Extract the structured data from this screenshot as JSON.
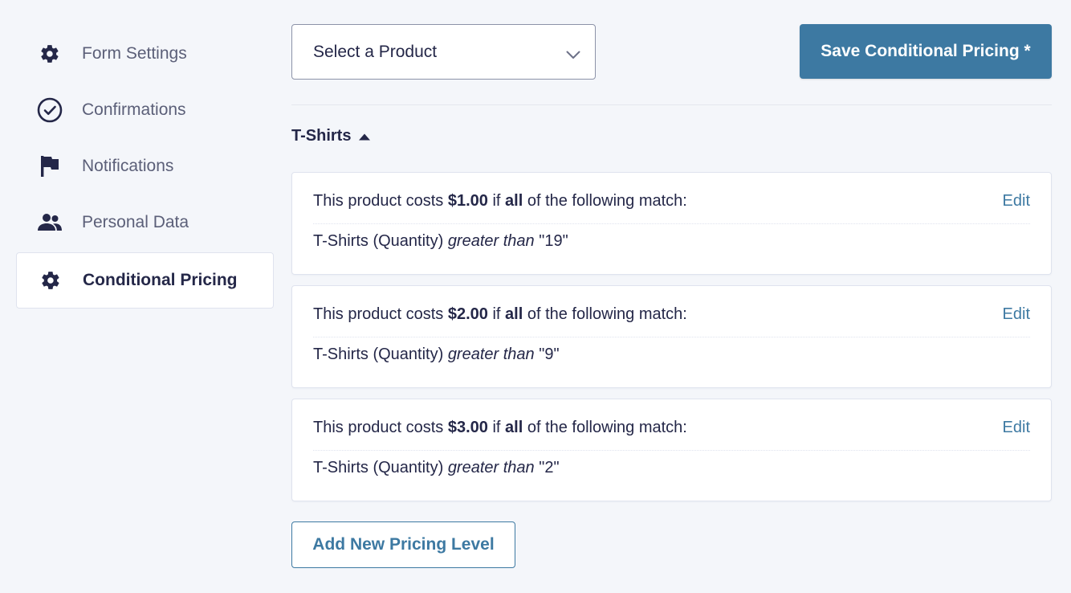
{
  "sidebar": {
    "items": [
      {
        "label": "Form Settings",
        "icon": "gear-icon"
      },
      {
        "label": "Confirmations",
        "icon": "check-circle-icon"
      },
      {
        "label": "Notifications",
        "icon": "flag-icon"
      },
      {
        "label": "Personal Data",
        "icon": "users-icon"
      },
      {
        "label": "Conditional Pricing",
        "icon": "gear-icon",
        "active": true
      }
    ]
  },
  "toolbar": {
    "product_select": "Select a Product",
    "save_label": "Save Conditional Pricing *"
  },
  "group": {
    "title": "T-Shirts",
    "expanded": true
  },
  "rules": [
    {
      "prefix": "This product costs ",
      "price": "$1.00",
      "mid": " if ",
      "match": "all",
      "suffix": " of the following match:",
      "edit_label": "Edit",
      "field": "T-Shirts (Quantity) ",
      "operator": "greater than",
      "value": " \"19\""
    },
    {
      "prefix": "This product costs ",
      "price": "$2.00",
      "mid": " if ",
      "match": "all",
      "suffix": " of the following match:",
      "edit_label": "Edit",
      "field": "T-Shirts (Quantity) ",
      "operator": "greater than",
      "value": " \"9\""
    },
    {
      "prefix": "This product costs ",
      "price": "$3.00",
      "mid": " if ",
      "match": "all",
      "suffix": " of the following match:",
      "edit_label": "Edit",
      "field": "T-Shirts (Quantity) ",
      "operator": "greater than",
      "value": " \"2\""
    }
  ],
  "add_label": "Add New Pricing Level",
  "colors": {
    "accent": "#3d79a2",
    "text": "#242748",
    "muted": "#5b5f78",
    "background": "#f4f6fa"
  }
}
